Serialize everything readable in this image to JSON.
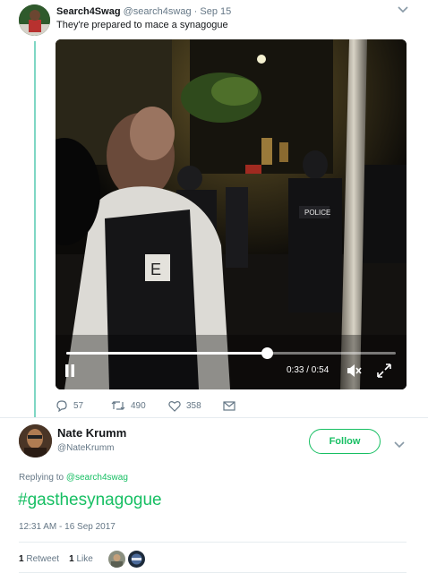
{
  "parent_tweet": {
    "author_name": "Search4Swag",
    "author_handle": "@search4swag",
    "separator": "·",
    "date": "Sep 15",
    "text": "They're prepared to mace a synagogue",
    "video": {
      "progress": 0.61,
      "time_readout": "0:33 / 0:54",
      "pause_icon": "pause-icon",
      "mute_icon": "volume-muted-icon",
      "fullscreen_icon": "fullscreen-icon",
      "scene_text": {
        "vest_label": "POLICE",
        "shirt_letters": "E"
      }
    },
    "actions": {
      "replies": "57",
      "retweets": "490",
      "likes": "358"
    }
  },
  "reply_tweet": {
    "author_name": "Nate Krumm",
    "author_handle": "@NateKrumm",
    "follow_label": "Follow",
    "replying_prefix": "Replying to",
    "replying_to": "@search4swag",
    "text": "#gasthesynagogue",
    "timestamp": "12:31 AM - 16 Sep 2017",
    "retweets_count": "1",
    "retweets_label": "Retweet",
    "likes_count": "1",
    "likes_label": "Like"
  },
  "colors": {
    "accent": "#17bf63",
    "thread_line": "#7fd7c4",
    "muted_text": "#657786",
    "divider": "#e6ecf0"
  }
}
